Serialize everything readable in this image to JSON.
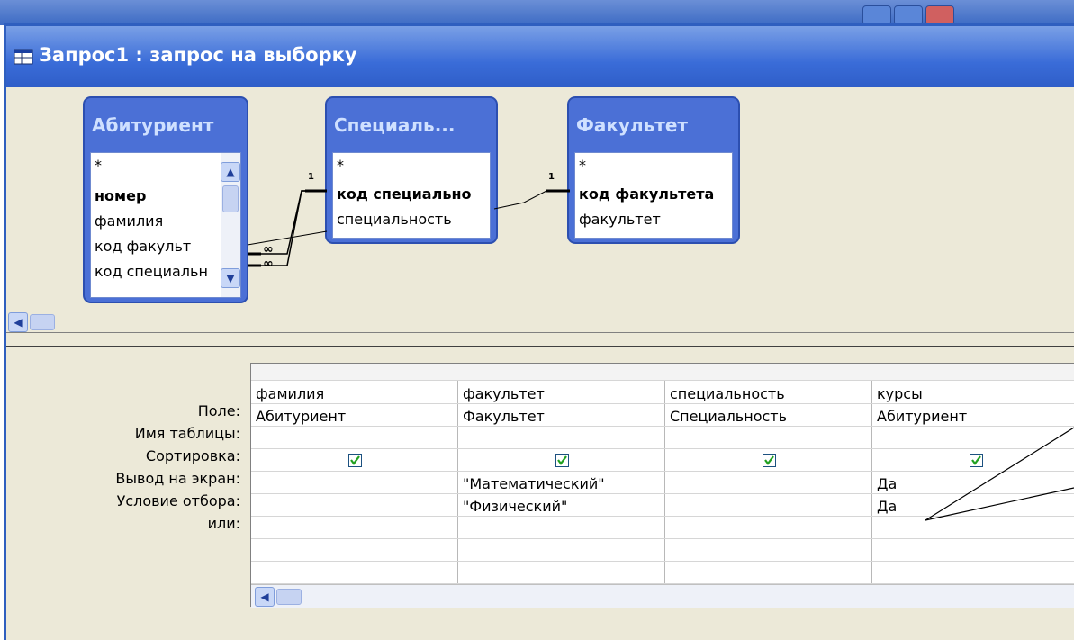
{
  "window": {
    "title": "Запрос1 : запрос на выборку"
  },
  "tables": [
    {
      "title": "Абитуриент",
      "fields": [
        {
          "name": "*",
          "bold": false
        },
        {
          "name": "номер",
          "bold": true
        },
        {
          "name": "фамилия",
          "bold": false
        },
        {
          "name": "код факульт",
          "bold": false
        },
        {
          "name": "код специальн",
          "bold": false
        }
      ]
    },
    {
      "title": "Специаль...",
      "fields": [
        {
          "name": "*",
          "bold": false
        },
        {
          "name": "код специально",
          "bold": true
        },
        {
          "name": "специальность",
          "bold": false
        }
      ]
    },
    {
      "title": "Факультет",
      "fields": [
        {
          "name": "*",
          "bold": false
        },
        {
          "name": "код факультета",
          "bold": true
        },
        {
          "name": "факультет",
          "bold": false
        }
      ]
    }
  ],
  "relations": {
    "one": "1",
    "many": "∞"
  },
  "grid": {
    "row_labels": [
      "Поле:",
      "Имя таблицы:",
      "Сортировка:",
      "Вывод на экран:",
      "Условие отбора:",
      "или:"
    ],
    "columns": [
      {
        "field": "фамилия",
        "table": "Абитуриент",
        "sort": "",
        "show": true,
        "criteria": "",
        "or": ""
      },
      {
        "field": "факультет",
        "table": "Факультет",
        "sort": "",
        "show": true,
        "criteria": "\"Математический\"",
        "or": "\"Физический\""
      },
      {
        "field": "специальность",
        "table": "Специальность",
        "sort": "",
        "show": true,
        "criteria": "",
        "or": ""
      },
      {
        "field": "курсы",
        "table": "Абитуриент",
        "sort": "",
        "show": true,
        "criteria": "Да",
        "or": "Да"
      }
    ]
  },
  "colors": {
    "title_blue": "#3a6cd8",
    "table_blue": "#4b70d6",
    "window_bg": "#ece9d8",
    "check_green": "#21a121"
  }
}
